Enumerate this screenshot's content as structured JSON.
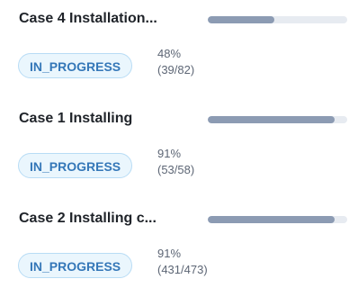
{
  "cases": [
    {
      "title": "Case 4 Installation...",
      "status": "IN_PROGRESS",
      "percent_label": "48%",
      "count_label": "(39/82)",
      "progress_fraction": 0.48
    },
    {
      "title": "Case 1 Installing",
      "status": "IN_PROGRESS",
      "percent_label": "91%",
      "count_label": "(53/58)",
      "progress_fraction": 0.91
    },
    {
      "title": "Case 2 Installing c...",
      "status": "IN_PROGRESS",
      "percent_label": "91%",
      "count_label": "(431/473)",
      "progress_fraction": 0.91
    }
  ],
  "colors": {
    "badge_background": "#eaf6fd",
    "badge_border": "#b8dcf5",
    "badge_text": "#3477b8",
    "progress_fill": "#8c9bb3",
    "progress_track": "#e7ebf1"
  }
}
